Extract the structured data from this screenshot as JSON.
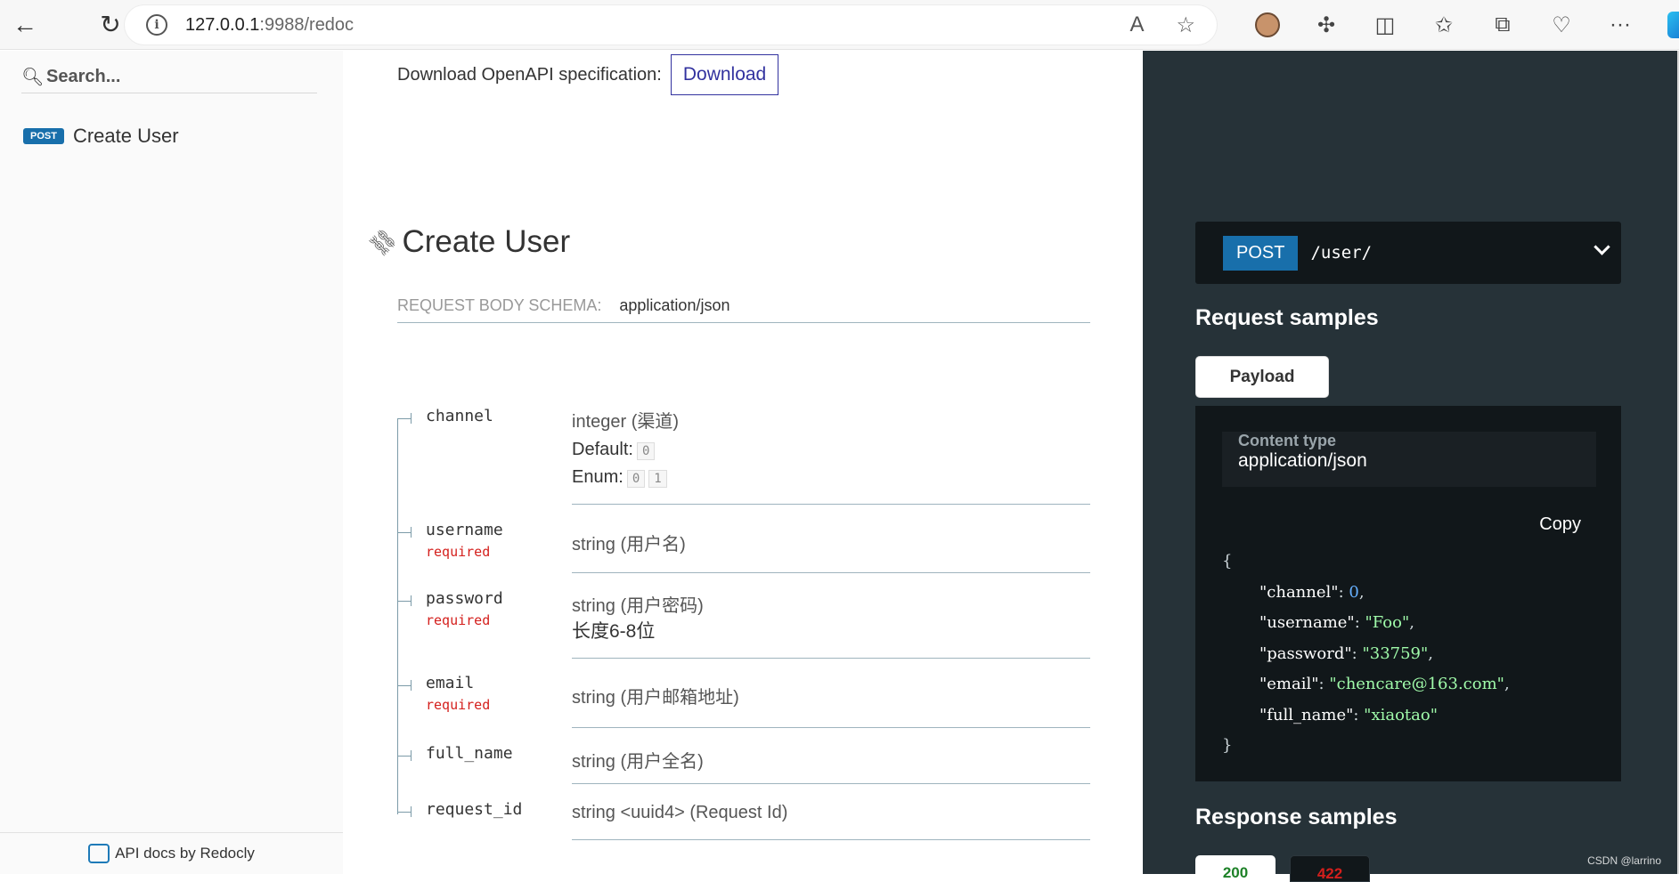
{
  "browser": {
    "url_host": "127.0.0.1",
    "url_rest": ":9988/redoc"
  },
  "sidebar": {
    "search_placeholder": "Search...",
    "items": [
      {
        "method": "POST",
        "label": "Create User"
      }
    ],
    "footer": "API docs by Redocly"
  },
  "main": {
    "download_label": "Download OpenAPI specification:",
    "download_button": "Download",
    "op_title": "Create User",
    "schema_label": "REQUEST BODY SCHEMA:",
    "schema_type": "application/json",
    "props": [
      {
        "name": "channel",
        "required": "",
        "type": "integer (渠道)",
        "default_label": "Default:",
        "default_value": "0",
        "enum_label": "Enum:",
        "enum_values": [
          "0",
          "1"
        ]
      },
      {
        "name": "username",
        "required": "required",
        "type": "string (用户名)"
      },
      {
        "name": "password",
        "required": "required",
        "type": "string (用户密码)",
        "desc": "长度6-8位"
      },
      {
        "name": "email",
        "required": "required",
        "type": "string (用户邮箱地址)"
      },
      {
        "name": "full_name",
        "required": "",
        "type": "string (用户全名)"
      },
      {
        "name": "request_id",
        "required": "",
        "type": "string <uuid4> (Request Id)"
      }
    ]
  },
  "right": {
    "method": "POST",
    "path": "/user/",
    "request_samples": "Request samples",
    "payload_tab": "Payload",
    "content_type_label": "Content type",
    "content_type_value": "application/json",
    "copy": "Copy",
    "code": {
      "open": "{",
      "close": "}",
      "lines": [
        {
          "key": "\"channel\"",
          "value": "0",
          "kind": "num",
          "comma": ","
        },
        {
          "key": "\"username\"",
          "value": "\"Foo\"",
          "kind": "str",
          "comma": ","
        },
        {
          "key": "\"password\"",
          "value": "\"33759\"",
          "kind": "str",
          "comma": ","
        },
        {
          "key": "\"email\"",
          "value": "\"chencare@163.com\"",
          "kind": "str",
          "comma": ","
        },
        {
          "key": "\"full_name\"",
          "value": "\"xiaotao\"",
          "kind": "str",
          "comma": ""
        }
      ]
    },
    "response_samples": "Response samples",
    "response_tabs": [
      "200",
      "422"
    ],
    "watermark": "CSDN @larrino"
  },
  "colors": {
    "post_badge": "#186fab",
    "download_accent": "#32329f",
    "required": "#d41f1c",
    "right_panel": "#263238",
    "code_bg": "#11171a",
    "string_value": "#a0fbaa"
  }
}
